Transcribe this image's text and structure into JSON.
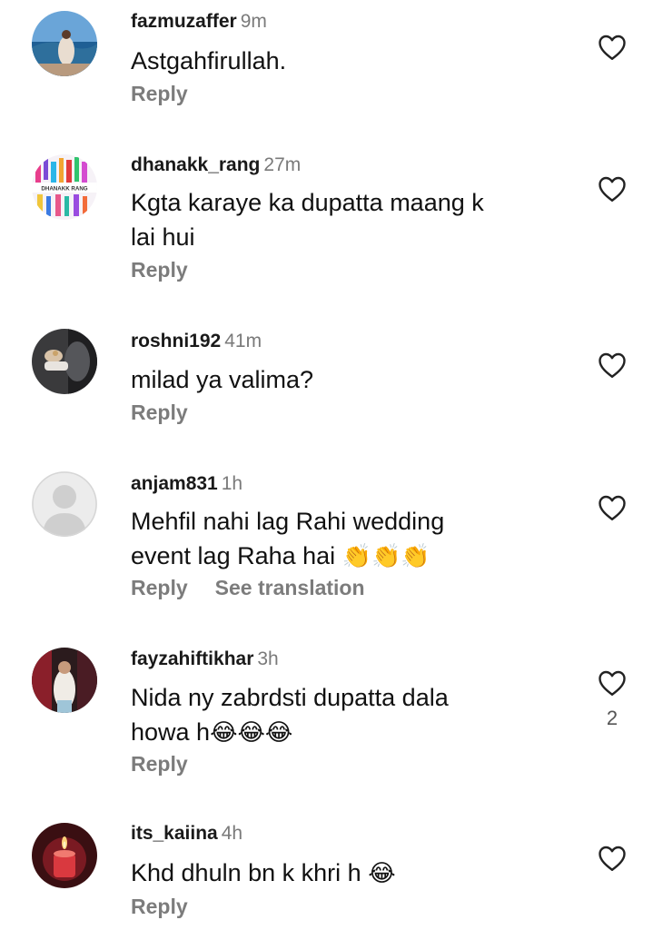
{
  "comments": [
    {
      "username": "fazmuzaffer",
      "time": "9m",
      "lines": [
        "Astgahfirullah."
      ],
      "reply": "Reply",
      "avatar": "landscape-avatar"
    },
    {
      "username": "dhanakk_rang",
      "time": "27m",
      "lines": [
        "Kgta karaye ka dupatta maang k",
        "lai hui"
      ],
      "reply": "Reply",
      "avatar": "colorful-brand-avatar",
      "avatar_text": "DHANAKK RANG"
    },
    {
      "username": "roshni192",
      "time": "41m",
      "lines": [
        "milad ya valima?"
      ],
      "reply": "Reply",
      "avatar": "dark-photo-avatar"
    },
    {
      "username": "anjam831",
      "time": "1h",
      "lines": [
        "Mehfil nahi lag Rahi wedding",
        "event lag Raha hai"
      ],
      "emoji": "👏👏👏",
      "reply": "Reply",
      "translation": "See translation",
      "avatar": "default-avatar"
    },
    {
      "username": "fayzahiftikhar",
      "time": "3h",
      "lines": [
        "Nida ny zabrdsti dupatta dala",
        "howa h"
      ],
      "emoji": "😂😂😂",
      "reply": "Reply",
      "likes": "2",
      "avatar": "photo-avatar"
    },
    {
      "username": "its_kaiina",
      "time": "4h",
      "lines": [
        "Khd dhuln bn k khri h"
      ],
      "emoji": "😂",
      "reply": "Reply",
      "avatar": "candle-avatar"
    }
  ],
  "icons": {
    "like": "heart-outline-icon"
  },
  "colors": {
    "username": "#1a1a1a",
    "meta": "#7c7c7c",
    "background": "#ffffff"
  }
}
